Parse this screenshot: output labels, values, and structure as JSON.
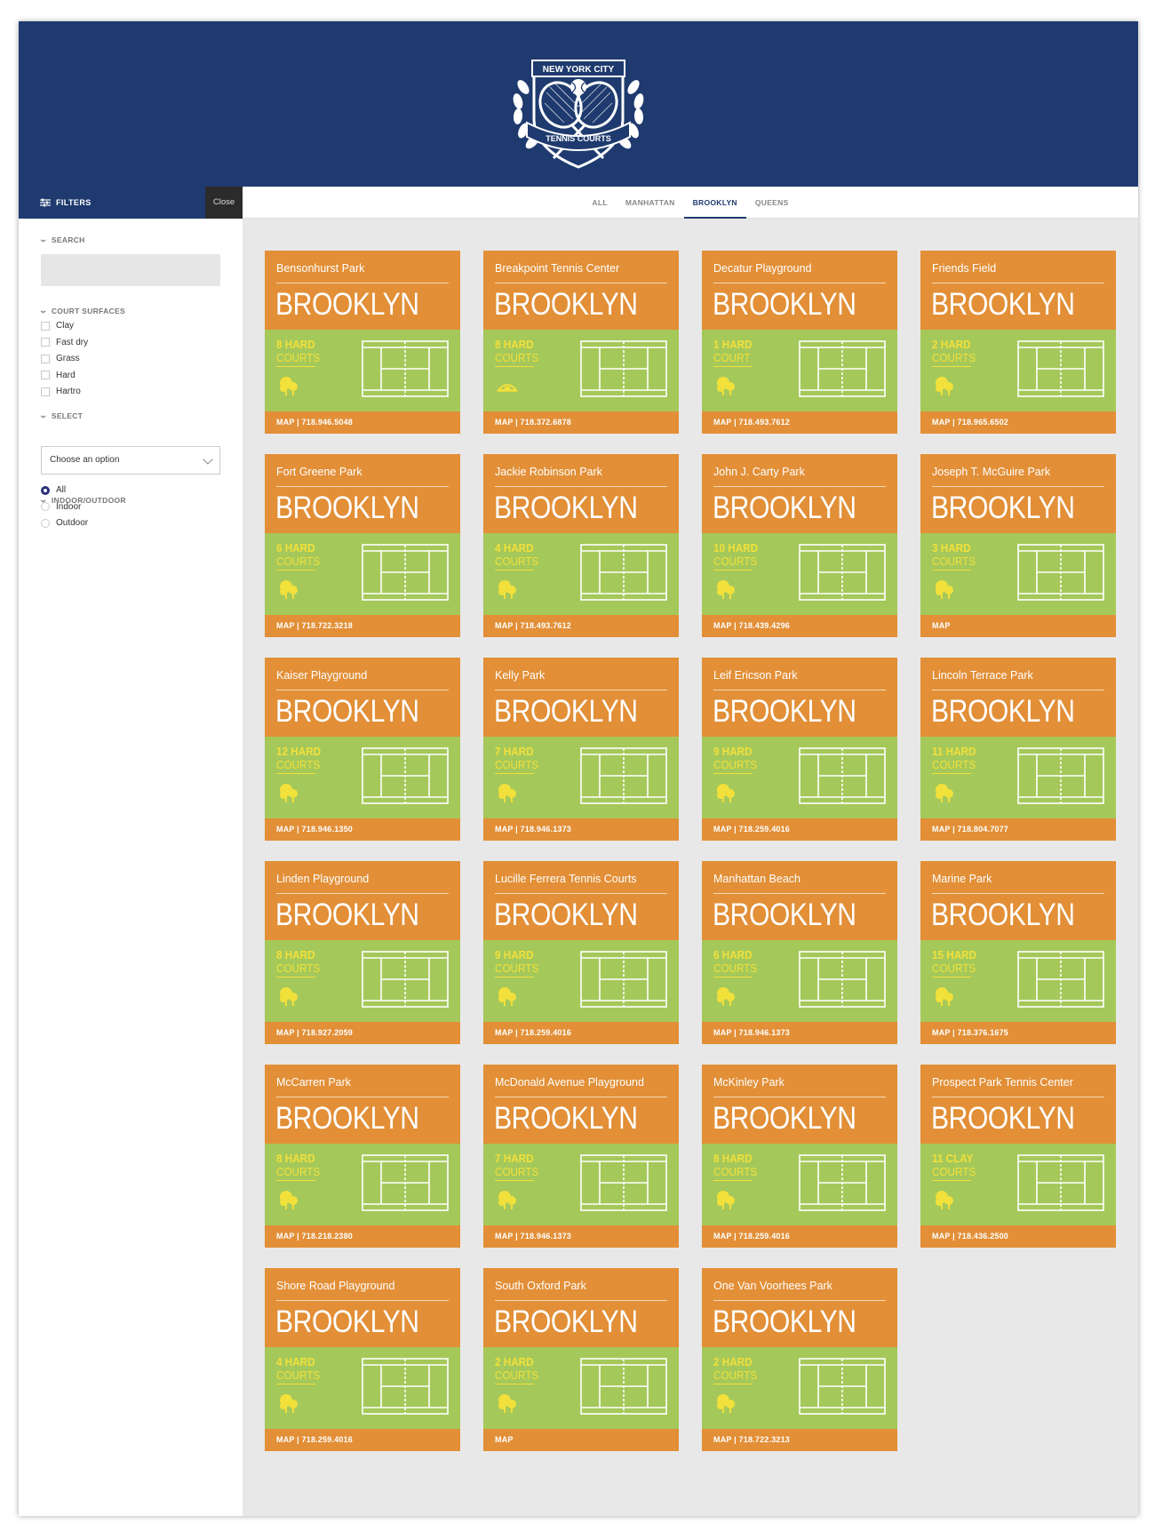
{
  "header": {
    "logo_top": "NEW YORK CITY",
    "logo_bottom": "TENNIS COURTS"
  },
  "filters": {
    "label": "FILTERS",
    "close": "Close",
    "search_title": "SEARCH",
    "surfaces_title": "COURT SURFACES",
    "surfaces": [
      "Clay",
      "Fast dry",
      "Grass",
      "Hard",
      "Hartro"
    ],
    "select_title": "SELECT",
    "select_value": "Choose an option",
    "io_title": "INDOOR/OUTDOOR",
    "io_options": [
      "All",
      "Indoor",
      "Outdoor"
    ],
    "io_selected": "All"
  },
  "tabs": [
    {
      "label": "ALL",
      "active": false
    },
    {
      "label": "MANHATTAN",
      "active": false
    },
    {
      "label": "BROOKLYN",
      "active": true
    },
    {
      "label": "QUEENS",
      "active": false
    }
  ],
  "colors": {
    "header_bg": "#1e3a6e",
    "card_orange": "#e28f37",
    "card_green": "#a5c85a",
    "count_yellow": "#f2e03b"
  },
  "cards": [
    {
      "name": "Bensonhurst Park",
      "borough": "BROOKLYN",
      "count": "8 HARD",
      "unit": "COURTS",
      "amenity": "tree-icon",
      "footer": "MAP | 718.946.5048"
    },
    {
      "name": "Breakpoint Tennis Center",
      "borough": "BROOKLYN",
      "count": "8 HARD",
      "unit": "COURTS",
      "amenity": "bubble-icon",
      "footer": "MAP | 718.372.6878"
    },
    {
      "name": "Decatur Playground",
      "borough": "BROOKLYN",
      "count": "1 HARD",
      "unit": "COURT",
      "amenity": "tree-icon",
      "footer": "MAP | 718.493.7612"
    },
    {
      "name": "Friends Field",
      "borough": "BROOKLYN",
      "count": "2 HARD",
      "unit": "COURTS",
      "amenity": "tree-icon",
      "footer": "MAP | 718.965.6502"
    },
    {
      "name": "Fort Greene Park",
      "borough": "BROOKLYN",
      "count": "6 HARD",
      "unit": "COURTS",
      "amenity": "tree-icon",
      "footer": "MAP | 718.722.3218"
    },
    {
      "name": "Jackie Robinson Park",
      "borough": "BROOKLYN",
      "count": "4 HARD",
      "unit": "COURTS",
      "amenity": "tree-icon",
      "footer": "MAP | 718.493.7612"
    },
    {
      "name": "John J. Carty Park",
      "borough": "BROOKLYN",
      "count": "10 HARD",
      "unit": "COURTS",
      "amenity": "tree-icon",
      "footer": "MAP | 718.439.4296"
    },
    {
      "name": "Joseph T. McGuire Park",
      "borough": "BROOKLYN",
      "count": "3 HARD",
      "unit": "COURTS",
      "amenity": "tree-icon",
      "footer": "MAP"
    },
    {
      "name": "Kaiser Playground",
      "borough": "BROOKLYN",
      "count": "12 HARD",
      "unit": "COURTS",
      "amenity": "tree-icon",
      "footer": "MAP | 718.946.1350"
    },
    {
      "name": "Kelly Park",
      "borough": "BROOKLYN",
      "count": "7 HARD",
      "unit": "COURTS",
      "amenity": "tree-icon",
      "footer": "MAP | 718.946.1373"
    },
    {
      "name": "Leif Ericson Park",
      "borough": "BROOKLYN",
      "count": "9 HARD",
      "unit": "COURTS",
      "amenity": "tree-icon",
      "footer": "MAP | 718.259.4016"
    },
    {
      "name": "Lincoln Terrace Park",
      "borough": "BROOKLYN",
      "count": "11 HARD",
      "unit": "COURTS",
      "amenity": "tree-icon",
      "footer": "MAP | 718.804.7077"
    },
    {
      "name": "Linden Playground",
      "borough": "BROOKLYN",
      "count": "8 HARD",
      "unit": "COURTS",
      "amenity": "tree-icon",
      "footer": "MAP | 718.927.2059"
    },
    {
      "name": "Lucille Ferrera Tennis Courts",
      "borough": "BROOKLYN",
      "count": "9 HARD",
      "unit": "COURTS",
      "amenity": "tree-icon",
      "footer": "MAP | 718.259.4016"
    },
    {
      "name": "Manhattan Beach",
      "borough": "BROOKLYN",
      "count": "6 HARD",
      "unit": "COURTS",
      "amenity": "tree-icon",
      "footer": "MAP | 718.946.1373"
    },
    {
      "name": "Marine Park",
      "borough": "BROOKLYN",
      "count": "15 HARD",
      "unit": "COURTS",
      "amenity": "tree-icon",
      "footer": "MAP | 718.376.1675"
    },
    {
      "name": "McCarren Park",
      "borough": "BROOKLYN",
      "count": "8 HARD",
      "unit": "COURTS",
      "amenity": "tree-icon",
      "footer": "MAP | 718.218.2380"
    },
    {
      "name": "McDonald Avenue Playground",
      "borough": "BROOKLYN",
      "count": "7 HARD",
      "unit": "COURTS",
      "amenity": "tree-icon",
      "footer": "MAP | 718.946.1373"
    },
    {
      "name": "McKinley Park",
      "borough": "BROOKLYN",
      "count": "8 HARD",
      "unit": "COURTS",
      "amenity": "tree-icon",
      "footer": "MAP | 718.259.4016"
    },
    {
      "name": "Prospect Park Tennis Center",
      "borough": "BROOKLYN",
      "count": "11 CLAY",
      "unit": "COURTS",
      "amenity": "tree-icon",
      "footer": "MAP | 718.436.2500"
    },
    {
      "name": "Shore Road Playground",
      "borough": "BROOKLYN",
      "count": "4 HARD",
      "unit": "COURTS",
      "amenity": "tree-icon",
      "footer": "MAP | 718.259.4016"
    },
    {
      "name": "South Oxford Park",
      "borough": "BROOKLYN",
      "count": "2 HARD",
      "unit": "COURTS",
      "amenity": "tree-icon",
      "footer": "MAP"
    },
    {
      "name": "One Van Voorhees Park",
      "borough": "BROOKLYN",
      "count": "2 HARD",
      "unit": "COURTS",
      "amenity": "tree-icon",
      "footer": "MAP | 718.722.3213"
    }
  ]
}
